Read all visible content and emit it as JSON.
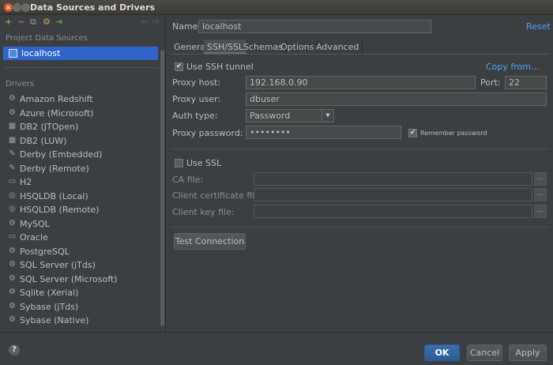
{
  "window": {
    "title": "Data Sources and Drivers"
  },
  "toolbar": {
    "add": "+",
    "remove": "−",
    "copy": "⧉",
    "settings": "⚙",
    "import": "⇥",
    "back": "⇦",
    "forward": "⇨"
  },
  "left": {
    "project_header": "Project Data Sources",
    "datasource": "localhost",
    "drivers_header": "Drivers",
    "drivers": [
      {
        "label": "Amazon Redshift",
        "icon": "⚙"
      },
      {
        "label": "Azure (Microsoft)",
        "icon": "⚙"
      },
      {
        "label": "DB2 (JTOpen)",
        "icon": "▦"
      },
      {
        "label": "DB2 (LUW)",
        "icon": "▦"
      },
      {
        "label": "Derby (Embedded)",
        "icon": "✎"
      },
      {
        "label": "Derby (Remote)",
        "icon": "✎"
      },
      {
        "label": "H2",
        "icon": "▭"
      },
      {
        "label": "HSQLDB (Local)",
        "icon": "◎"
      },
      {
        "label": "HSQLDB (Remote)",
        "icon": "◎"
      },
      {
        "label": "MySQL",
        "icon": "⚙"
      },
      {
        "label": "Oracle",
        "icon": "▭"
      },
      {
        "label": "PostgreSQL",
        "icon": "⚙"
      },
      {
        "label": "SQL Server (jTds)",
        "icon": "⚙"
      },
      {
        "label": "SQL Server (Microsoft)",
        "icon": "⚙"
      },
      {
        "label": "Sqlite (Xerial)",
        "icon": "⚙"
      },
      {
        "label": "Sybase (jTds)",
        "icon": "⚙"
      },
      {
        "label": "Sybase (Native)",
        "icon": "⚙"
      }
    ]
  },
  "main": {
    "name_label": "Name:",
    "name_value": "localhost",
    "reset": "Reset",
    "tabs": [
      "General",
      "SSH/SSL",
      "Schemas",
      "Options",
      "Advanced"
    ],
    "use_ssh": "Use SSH tunnel",
    "use_ssh_checked": "✔",
    "copy_from": "Copy from...",
    "proxy_host_label": "Proxy host:",
    "proxy_host_value": "192.168.0.90",
    "port_label": "Port:",
    "port_value": "22",
    "proxy_user_label": "Proxy user:",
    "proxy_user_value": "dbuser",
    "auth_type_label": "Auth type:",
    "auth_type_value": "Password",
    "proxy_password_label": "Proxy password:",
    "proxy_password_value": "••••••••",
    "remember_password": "Remember password",
    "remember_checked": "✔",
    "use_ssl": "Use SSL",
    "ca_file_label": "CA file:",
    "client_cert_label": "Client certificate file:",
    "client_key_label": "Client key file:",
    "browse": "...",
    "test_connection": "Test Connection"
  },
  "footer": {
    "help": "?",
    "ok": "OK",
    "cancel": "Cancel",
    "apply": "Apply"
  }
}
